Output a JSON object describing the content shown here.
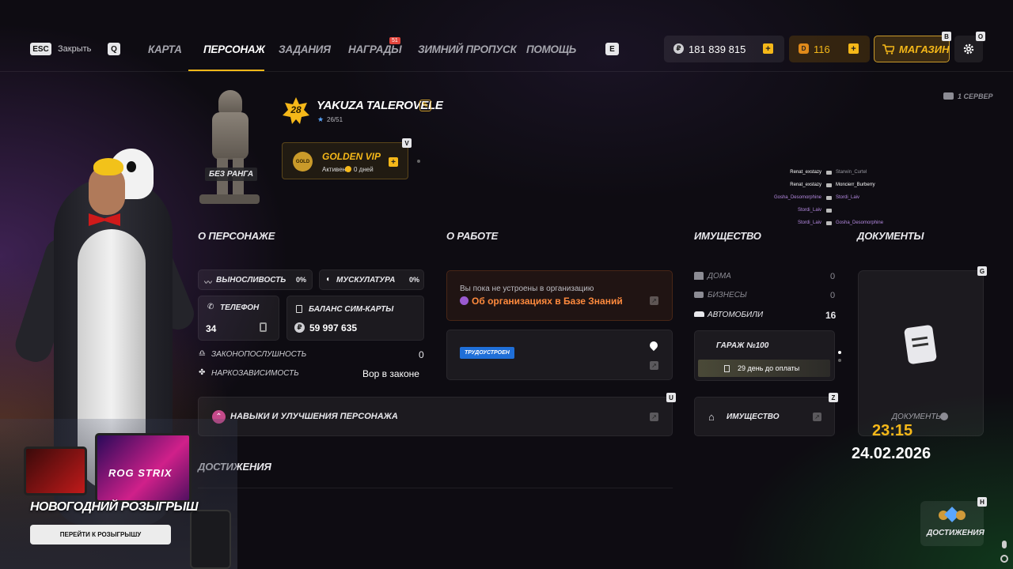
{
  "nav": {
    "esc_key": "ESC",
    "close_label": "Закрыть",
    "q_key": "Q",
    "e_key": "E",
    "tabs": [
      {
        "label": "КАРТА",
        "active": false
      },
      {
        "label": "ПЕРСОНАЖ",
        "active": true
      },
      {
        "label": "ЗАДАНИЯ",
        "active": false
      },
      {
        "label": "НАГРАДЫ",
        "active": false,
        "badge": "51"
      },
      {
        "label": "ЗИМНИЙ ПРОПУСК",
        "active": false
      },
      {
        "label": "ПОМОЩЬ",
        "active": false
      }
    ],
    "money": "181 839 815",
    "coins": "116",
    "shop_label": "МАГАЗИН",
    "shop_key": "B",
    "settings_key": "O"
  },
  "server": "1 СЕРВЕР",
  "profile": {
    "level": "28",
    "name": "YAKUZA TALEROVELE",
    "sub_level": "26/51",
    "rank_label": "БЕЗ РАНГА"
  },
  "vip": {
    "badge": "GOLD",
    "title": "GOLDEN VIP",
    "status": "Активен",
    "days": "0 дней",
    "key": "V"
  },
  "killfeed": [
    {
      "killer": "Renat_exstazy",
      "victim": "Starwin_Curtel",
      "k_color": "#ffffff",
      "v_color": "#9a9aa2"
    },
    {
      "killer": "Renat_exstazy",
      "victim": "Moncierr_Burberry",
      "k_color": "#ffffff",
      "v_color": "#ffffff"
    },
    {
      "killer": "Gosha_Desomorphine",
      "victim": "Stordi_Laiv",
      "k_color": "#b489e0",
      "v_color": "#b489e0"
    },
    {
      "killer": "Stordi_Laiv",
      "victim": "",
      "k_color": "#b489e0",
      "v_color": "#b489e0"
    },
    {
      "killer": "Stordi_Laiv",
      "victim": "Gosha_Desomorphine",
      "k_color": "#b489e0",
      "v_color": "#b489e0"
    }
  ],
  "about": {
    "title": "О ПЕРСОНАЖЕ",
    "stamina_label": "ВЫНОСЛИВОСТЬ",
    "stamina_value": "0%",
    "muscle_label": "МУСКУЛАТУРА",
    "muscle_value": "0%",
    "phone_label": "ТЕЛЕФОН",
    "phone_value": "34",
    "sim_label": "БАЛАНС СИМ-КАРТЫ",
    "sim_value": "59 997 635",
    "law_label": "ЗАКОНОПОСЛУШНОСТЬ",
    "law_value": "0",
    "drug_label": "НАРКОЗАВИСИМОСТЬ",
    "drug_value": "Вор в законе",
    "skills_label": "НАВЫКИ И УЛУЧШЕНИЯ ПЕРСОНАЖА",
    "skills_key": "U"
  },
  "work": {
    "title": "О РАБОТЕ",
    "not_employed": "Вы пока не устроены в организацию",
    "kb_link": "Об организациях в Базе Знаний",
    "job_badge": "ТРУДОУСТРОЕН"
  },
  "property": {
    "title": "ИМУЩЕСТВО",
    "houses_label": "ДОМА",
    "houses_value": "0",
    "business_label": "БИЗНЕСЫ",
    "business_value": "0",
    "cars_label": "АВТОМОБИЛИ",
    "cars_value": "16",
    "garage_label": "ГАРАЖ №100",
    "garage_pay": "29 день до оплаты",
    "button_label": "ИМУЩЕСТВО",
    "key": "Z"
  },
  "documents": {
    "title": "ДОКУМЕНТЫ",
    "card_label": "ДОКУМЕНТЫ",
    "key": "G"
  },
  "achievements": {
    "title": "ДОСТИЖЕНИЯ",
    "button_label": "ДОСТИЖЕНИЯ",
    "key": "H"
  },
  "clock": {
    "time": "23:15",
    "date": "24.02.2026"
  },
  "promo": {
    "title": "НОВОГОДНИЙ РОЗЫГРЫШ",
    "button": "ПЕРЕЙТИ К РОЗЫГРЫШУ",
    "laptop_text": "ROG STRIX"
  },
  "colors": {
    "accent": "#f5b819",
    "vip_border": "#c99a2a",
    "job_badge": "#1f6fd8",
    "link": "#ff8a3d"
  }
}
